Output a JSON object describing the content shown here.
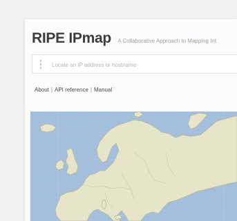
{
  "header": {
    "title": "RIPE IPmap",
    "subtitle": "A Collaborative Approach to Mapping Int"
  },
  "search": {
    "placeholder": "Locate an IP address or hostname",
    "value": ""
  },
  "nav": {
    "links": [
      "About",
      "API reference",
      "Manual"
    ],
    "separator": "|"
  },
  "map": {
    "region": "Europe",
    "colors": {
      "water": "#a4bfdb",
      "land": "#e6e5c9",
      "border": "#b6b497"
    }
  },
  "colors": {
    "page_background": "#f1f1f1",
    "card_background": "#fbfbfb",
    "title": "#3c3c3c",
    "subtitle": "#9aa0a6"
  },
  "icons": {
    "search": "search-grip-icon"
  }
}
